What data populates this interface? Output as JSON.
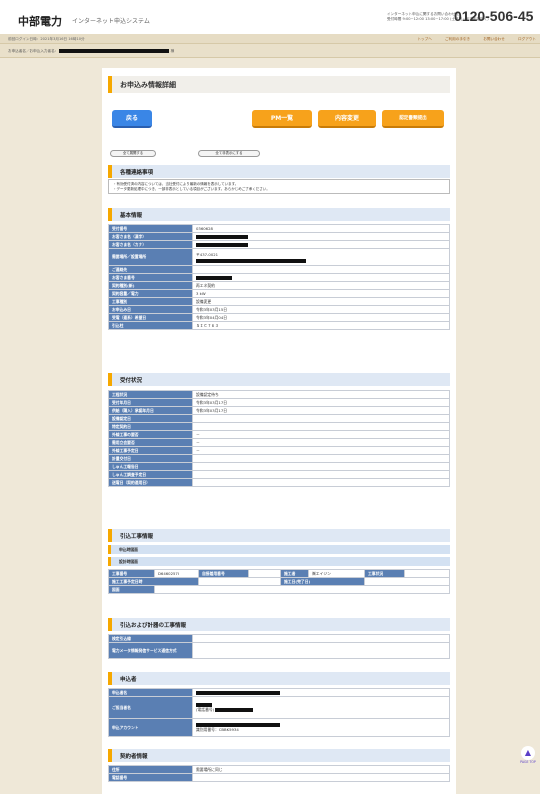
{
  "header": {
    "logo": "中部電力",
    "system_name": "インターネット申込システム",
    "tel_label_line1": "インターネット申込に関するお問い合わせ先",
    "tel_label_line2": "受付時間 9:00~12:00 13:00~17:00 (土日祝・年末年始除く)",
    "tel_number": "0120-506-45",
    "last_login": "前回ログイン日時：2021年3月16日 16時10分",
    "nav": [
      "トップへ",
      "ご利用の手引き",
      "お問い合わせ",
      "ログアウト"
    ],
    "applicant_label": "お申込者名／お申込入力者名："
  },
  "page": {
    "title": "お申込み情報詳細",
    "buttons": {
      "back": "戻る",
      "pm_list": "PM一覧",
      "change": "内容変更",
      "confirm": "認定書類提出"
    },
    "expand_all": "全て展開する",
    "collapse_all": "全て非表示にする"
  },
  "notes": {
    "title": "各種連絡事項",
    "lines": [
      "・有効受付済の内容については、当社受付により最新の情報を表示しています。",
      "・データ更新処理中につき、一部非表示としている項目がございます。あらかじめご了承ください。"
    ]
  },
  "basic": {
    "title": "基本情報",
    "rows": [
      {
        "label": "受付番号",
        "value": "0360628"
      },
      {
        "label": "お客さま名（漢字）",
        "value": ""
      },
      {
        "label": "お客さま名（カナ）",
        "value": ""
      },
      {
        "label": "需要場所／設置場所",
        "value": "〒437-0021"
      },
      {
        "label": "ご連絡先",
        "value": ""
      },
      {
        "label": "お客さま番号",
        "value": ""
      },
      {
        "label": "契約種別(新)",
        "value": "再エネ契約"
      },
      {
        "label": "契約容量／電力",
        "value": "3 kW"
      },
      {
        "label": "工事種別",
        "value": "設備変更"
      },
      {
        "label": "お申込み日",
        "value": "令和3年03月15日"
      },
      {
        "label": "受電（連系）希望日",
        "value": "令和3年04月04日"
      },
      {
        "label": "引込柱",
        "value": "ＳＩＣ７６３"
      }
    ]
  },
  "reception": {
    "title": "受付状況",
    "rows": [
      {
        "label": "工程状況",
        "value": "設備認定待ち"
      },
      {
        "label": "受付年月日",
        "value": "令和3年03月17日"
      },
      {
        "label": "供給（購入）承諾年月日",
        "value": "令和3年03月17日"
      },
      {
        "label": "設備認定日",
        "value": ""
      },
      {
        "label": "特定契約日",
        "value": ""
      },
      {
        "label": "外線工事の要否",
        "value": "－"
      },
      {
        "label": "需用立会要否",
        "value": "－"
      },
      {
        "label": "外線工事予定日",
        "value": "－"
      },
      {
        "label": "計量交付日",
        "value": ""
      },
      {
        "label": "しゅん工報告日",
        "value": ""
      },
      {
        "label": "しゅん工調査予定日",
        "value": ""
      },
      {
        "label": "送電日（契約適用日）",
        "value": ""
      }
    ]
  },
  "lead_in": {
    "title": "引込工事情報",
    "sub1": "申込時図面",
    "sub2": "設計時図面",
    "row1": {
      "l1": "工事番号",
      "v1": "D6460257I",
      "l2": "自接着用番号",
      "v2": "",
      "l3": "施工者",
      "v3": "㈱エイジン",
      "l4": "工事状況",
      "v4": ""
    },
    "row2": {
      "l1": "施工工事予定日時",
      "v1": "",
      "l2": "施工日(完了日)",
      "v2": ""
    },
    "row3": {
      "l1": "図面",
      "v1": ""
    }
  },
  "meter": {
    "title": "引込および計器の工事情報",
    "rows": [
      {
        "label": "検定引込線",
        "value": ""
      },
      {
        "label": "電力メータ情報発信サービス通信方式",
        "value": ""
      }
    ]
  },
  "applicant": {
    "title": "申込者",
    "rows": [
      {
        "label": "申込者名",
        "value": ""
      },
      {
        "label": "ご担当者名",
        "value": "(電話番号)"
      },
      {
        "label": "申込アカウント",
        "value": "識別用番号：CBBK5934"
      }
    ]
  },
  "contractor": {
    "title": "契約者情報",
    "rows": [
      {
        "label": "住所",
        "value": "需要場所に同じ"
      },
      {
        "label": "電話番号",
        "value": ""
      }
    ]
  },
  "pagetop": {
    "label": "PAGE TOP",
    "arrow": "▲"
  }
}
